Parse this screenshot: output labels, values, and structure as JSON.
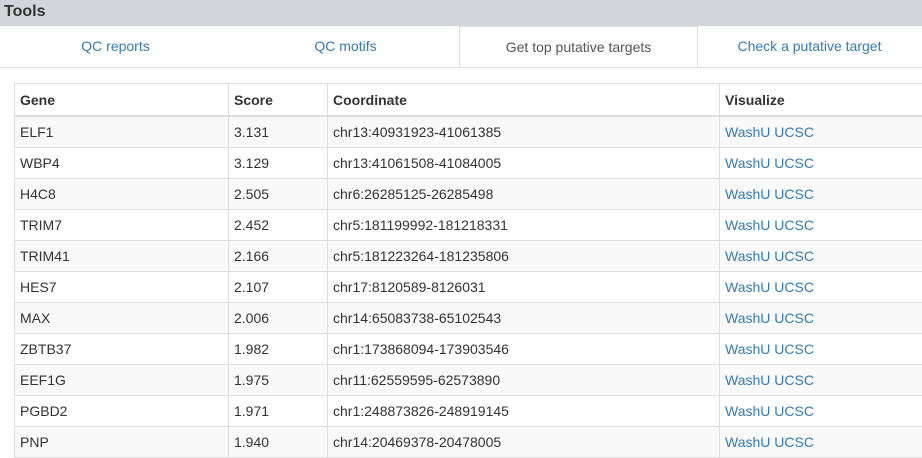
{
  "header": {
    "title": "Tools"
  },
  "tabs": [
    {
      "label": "QC reports"
    },
    {
      "label": "QC motifs"
    },
    {
      "label": "Get top putative targets"
    },
    {
      "label": "Check a putative target"
    }
  ],
  "table": {
    "columns": [
      "Gene",
      "Score",
      "Coordinate",
      "Visualize"
    ],
    "rows": [
      {
        "gene": "ELF1",
        "score": "3.131",
        "coordinate": "chr13:40931923-41061385",
        "links": [
          "WashU",
          "UCSC"
        ]
      },
      {
        "gene": "WBP4",
        "score": "3.129",
        "coordinate": "chr13:41061508-41084005",
        "links": [
          "WashU",
          "UCSC"
        ]
      },
      {
        "gene": "H4C8",
        "score": "2.505",
        "coordinate": "chr6:26285125-26285498",
        "links": [
          "WashU",
          "UCSC"
        ]
      },
      {
        "gene": "TRIM7",
        "score": "2.452",
        "coordinate": "chr5:181199992-181218331",
        "links": [
          "WashU",
          "UCSC"
        ]
      },
      {
        "gene": "TRIM41",
        "score": "2.166",
        "coordinate": "chr5:181223264-181235806",
        "links": [
          "WashU",
          "UCSC"
        ]
      },
      {
        "gene": "HES7",
        "score": "2.107",
        "coordinate": "chr17:8120589-8126031",
        "links": [
          "WashU",
          "UCSC"
        ]
      },
      {
        "gene": "MAX",
        "score": "2.006",
        "coordinate": "chr14:65083738-65102543",
        "links": [
          "WashU",
          "UCSC"
        ]
      },
      {
        "gene": "ZBTB37",
        "score": "1.982",
        "coordinate": "chr1:173868094-173903546",
        "links": [
          "WashU",
          "UCSC"
        ]
      },
      {
        "gene": "EEF1G",
        "score": "1.975",
        "coordinate": "chr11:62559595-62573890",
        "links": [
          "WashU",
          "UCSC"
        ]
      },
      {
        "gene": "PGBD2",
        "score": "1.971",
        "coordinate": "chr1:248873826-248919145",
        "links": [
          "WashU",
          "UCSC"
        ]
      },
      {
        "gene": "PNP",
        "score": "1.940",
        "coordinate": "chr14:20469378-20478005",
        "links": [
          "WashU",
          "UCSC"
        ]
      }
    ]
  }
}
